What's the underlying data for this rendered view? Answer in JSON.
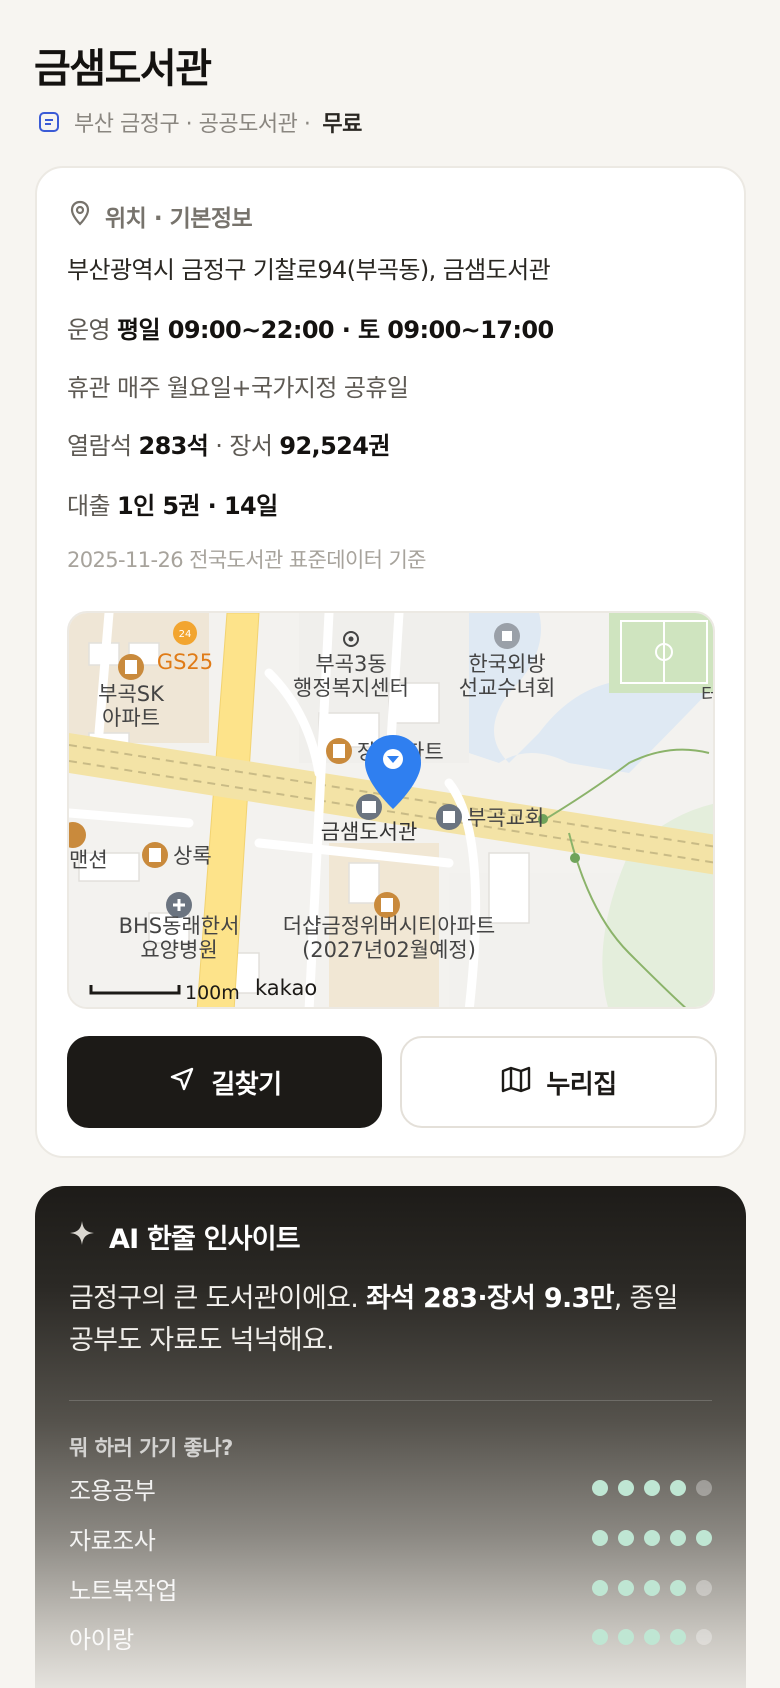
{
  "header": {
    "title": "금샘도서관",
    "subtitle_region": "부산 금정구 · 공공도서관 ·",
    "subtitle_fee": "무료",
    "subtitle_icon": "document-icon"
  },
  "info": {
    "section_title": "위치 · 기본정보",
    "section_icon": "location-pin-icon",
    "address": "부산광역시 금정구 기찰로94(부곡동), 금샘도서관",
    "hours_label": "운영",
    "hours_value": "평일 09:00~22:00 · 토 09:00~17:00",
    "closed_label": "휴관",
    "closed_value": "매주 월요일+국가지정 공휴일",
    "seats_label": "열람석",
    "seats_value": "283석",
    "books_label": "· 장서",
    "books_value": "92,524권",
    "loan_label": "대출",
    "loan_value": "1인 5권 · 14일",
    "source": "2025-11-26 전국도서관 표준데이터 기준"
  },
  "map": {
    "labels": {
      "gs25": "GS25",
      "bugok_sk_1": "부곡SK",
      "bugok_sk_2": "아파트",
      "center_1": "부곡3동",
      "center_2": "행정복지센터",
      "church_1": "한국외방",
      "church_2": "선교수녀회",
      "edge_right": "터",
      "apt_partial_1": "장",
      "apt_partial_2": "파트",
      "library": "금샘도서관",
      "bugok_church": "부곡교회",
      "mansion": "맨션",
      "sangrok": "상록",
      "hospital_1": "BHS동래한서",
      "hospital_2": "요양병원",
      "apt_new_1": "더샵금정위버시티아파트",
      "apt_new_2": "(2027년02월예정)",
      "scale": "100m",
      "brand": "kakao",
      "store_badge": "24"
    }
  },
  "actions": {
    "directions_label": "길찾기",
    "directions_icon": "navigation-arrow-icon",
    "website_label": "누리집",
    "website_icon": "map-fold-icon"
  },
  "ai": {
    "title": "AI 한줄 인사이트",
    "title_icon": "sparkle-icon",
    "text_prefix": "금정구의 큰 도서관이에요. ",
    "text_bold": "좌석 283·장서 9.3만",
    "text_suffix": ", 종일 공부도 자료도 넉넉해요.",
    "question": "뭐 하러 가기 좋나?",
    "ratings": [
      {
        "label": "조용공부",
        "score": 4,
        "max": 5
      },
      {
        "label": "자료조사",
        "score": 5,
        "max": 5
      },
      {
        "label": "노트북작업",
        "score": 4,
        "max": 5
      },
      {
        "label": "아이랑",
        "score": 4,
        "max": 5
      }
    ],
    "colors": {
      "dot_on": "#bfe6d3",
      "dot_off": "#6e6b66"
    }
  },
  "colors": {
    "background": "#f7f5f1",
    "primary_button": "#1c1a17",
    "map_pin": "#2f7ff0",
    "poi_orange": "#c98a3c"
  }
}
